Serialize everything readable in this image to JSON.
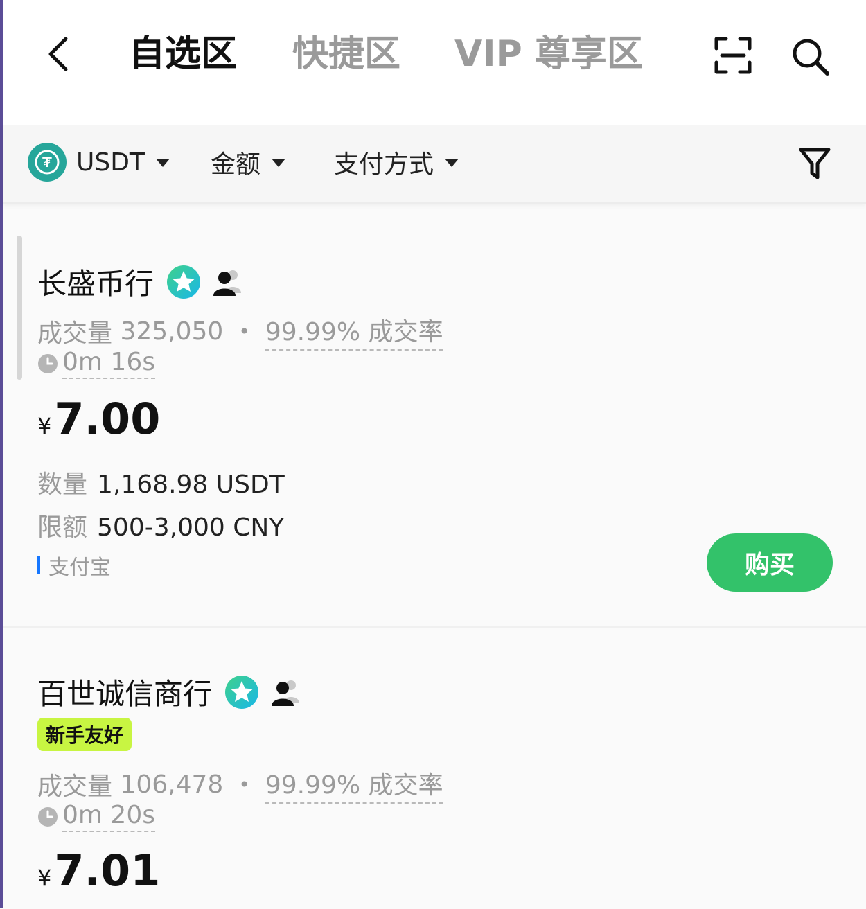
{
  "header": {
    "tabs": [
      {
        "label": "自选区",
        "active": true
      },
      {
        "label": "快捷区",
        "active": false
      },
      {
        "label": "VIP 尊享区",
        "active": false
      }
    ],
    "icons": {
      "back": "chevron-left-icon",
      "scan": "scan-icon",
      "search": "search-icon"
    }
  },
  "filters": {
    "coin": {
      "label": "USDT",
      "icon": "tether-icon",
      "icon_glyph": "₮"
    },
    "amount": {
      "label": "金额"
    },
    "payment": {
      "label": "支付方式"
    },
    "funnel_icon": "filter-funnel-icon"
  },
  "colors": {
    "buy_button": "#33c26a",
    "tether": "#26a69a",
    "newbie_tag": "#c8f542",
    "alipay_marker": "#1677ff",
    "inactive_tab": "#9a9a9a"
  },
  "listings": [
    {
      "merchant": "长盛币行",
      "volume_label": "成交量",
      "volume": "325,050",
      "separator": "•",
      "completion_rate": "99.99% 成交率",
      "response_time": "0m 16s",
      "currency_symbol": "¥",
      "price": "7.00",
      "quantity_label": "数量",
      "quantity": "1,168.98 USDT",
      "limit_label": "限额",
      "limit": "500-3,000 CNY",
      "payment_method": "支付宝",
      "buy_label": "购买"
    },
    {
      "merchant": "百世诚信商行",
      "tag": "新手友好",
      "volume_label": "成交量",
      "volume": "106,478",
      "separator": "•",
      "completion_rate": "99.99% 成交率",
      "response_time": "0m 20s",
      "currency_symbol": "¥",
      "price": "7.01"
    }
  ]
}
